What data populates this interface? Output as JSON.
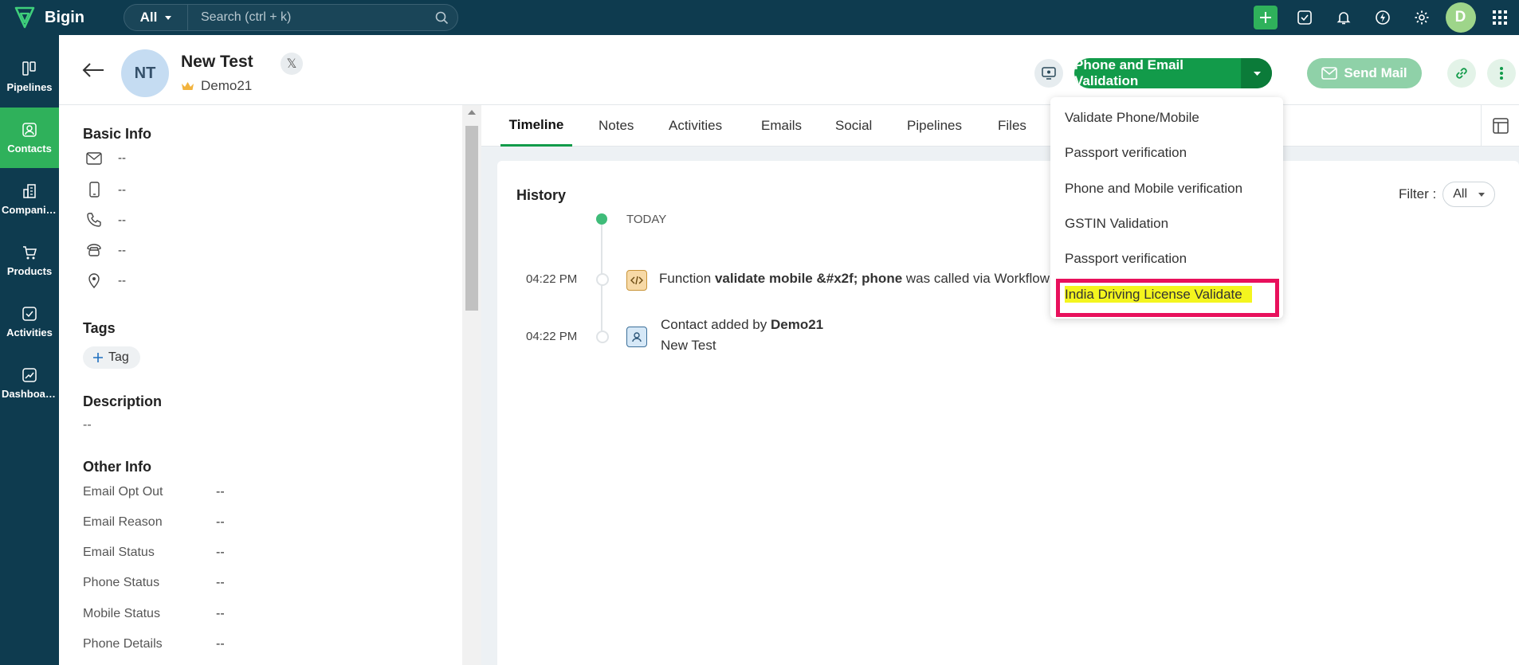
{
  "app": {
    "name": "Bigin"
  },
  "search": {
    "scope": "All",
    "placeholder": "Search (ctrl + k)"
  },
  "user": {
    "initial": "D"
  },
  "nav": [
    {
      "label": "Pipelines",
      "icon": "pipelines-icon"
    },
    {
      "label": "Contacts",
      "icon": "contacts-icon",
      "active": true
    },
    {
      "label": "Companies",
      "icon": "companies-icon"
    },
    {
      "label": "Products",
      "icon": "products-icon"
    },
    {
      "label": "Activities",
      "icon": "activities-icon"
    },
    {
      "label": "Dashboards",
      "icon": "dashboards-icon"
    }
  ],
  "record": {
    "initials": "NT",
    "name": "New Test",
    "owner": "Demo21",
    "primary_action": "Phone and Email Validation",
    "send_mail": "Send Mail"
  },
  "basic_info": {
    "title": "Basic Info",
    "email": "--",
    "mobile": "--",
    "phone": "--",
    "landline": "--",
    "address": "--"
  },
  "tags": {
    "title": "Tags",
    "add_label": "Tag"
  },
  "description": {
    "title": "Description",
    "value": "--"
  },
  "other_info": {
    "title": "Other Info",
    "rows": [
      {
        "label": "Email Opt Out",
        "value": "--"
      },
      {
        "label": "Email Reason",
        "value": "--"
      },
      {
        "label": "Email Status",
        "value": "--"
      },
      {
        "label": "Phone Status",
        "value": "--"
      },
      {
        "label": "Mobile Status",
        "value": "--"
      },
      {
        "label": "Phone Details",
        "value": "--"
      }
    ]
  },
  "tabs": [
    "Timeline",
    "Notes",
    "Activities",
    "Emails",
    "Social",
    "Pipelines",
    "Files"
  ],
  "history": {
    "title": "History",
    "filter_label": "Filter :",
    "filter_value": "All",
    "today": "TODAY",
    "events": [
      {
        "time": "04:22 PM",
        "prefix": "Function ",
        "bold": "validate mobile &#x2f; phone",
        "suffix": " was called via Workflow"
      },
      {
        "time": "04:22 PM",
        "prefix": "Contact added by ",
        "bold": "Demo21",
        "line2": "New Test"
      }
    ]
  },
  "dropdown": {
    "items": [
      "Validate Phone/Mobile",
      "Passport verification",
      "Phone and Mobile verification",
      "GSTIN Validation",
      "Passport verification",
      "India Driving License Validate"
    ]
  },
  "colors": {
    "topbar": "#0e3b4f",
    "accent": "#129b4a",
    "active_nav": "#2fb15b",
    "highlight": "#f4f51e",
    "highlight_border": "#e8105c"
  }
}
